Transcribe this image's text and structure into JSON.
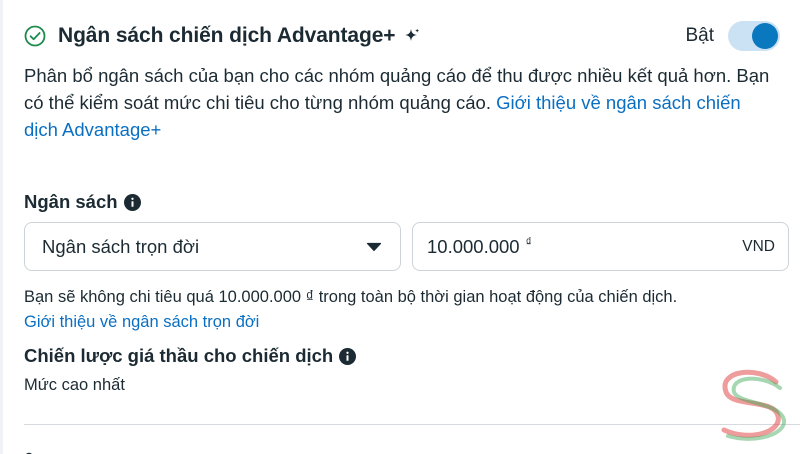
{
  "header": {
    "title": "Ngân sách chiến dịch Advantage+",
    "toggle_label": "Bật",
    "toggle_on": true
  },
  "description": {
    "text": "Phân bổ ngân sách của bạn cho các nhóm quảng cáo để thu được nhiều kết quả hơn. Bạn có thể kiểm soát mức chi tiêu cho từng nhóm quảng cáo.",
    "link": "Giới thiệu về ngân sách chiến dịch Advantage+"
  },
  "budget": {
    "label": "Ngân sách",
    "type_selected": "Ngân sách trọn đời",
    "amount": "10.000.000",
    "currency_symbol": "₫",
    "currency_code": "VND",
    "note": "Bạn sẽ không chi tiêu quá 10.000.000 ₫ trong toàn bộ thời gian hoạt động của chiến dịch.",
    "learn_more_link": "Giới thiệu về ngân sách trọn đời"
  },
  "bid_strategy": {
    "label": "Chiến lược giá thầu cho chiến dịch",
    "value": "Mức cao nhất"
  },
  "icons": {
    "header": "check-circle-icon",
    "title_badge": "sparkle-icon",
    "info": "info-icon",
    "dropdown": "caret-down-icon"
  },
  "colors": {
    "accent": "#0a78be",
    "link": "#0a6fc2",
    "toggle_track": "#cbe2f5",
    "text": "#1c2b33",
    "border": "#cdd3d8"
  }
}
